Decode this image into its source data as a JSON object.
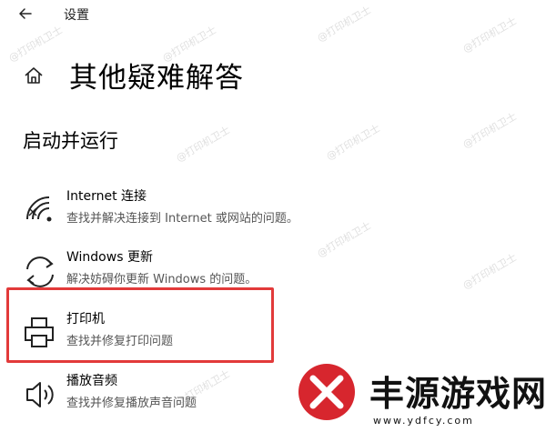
{
  "window": {
    "title": "设置"
  },
  "header": {
    "title": "其他疑难解答"
  },
  "section": {
    "title": "启动并运行"
  },
  "items": [
    {
      "title": "Internet 连接",
      "description": "查找并解决连接到 Internet 或网站的问题。",
      "icon": "wifi-icon"
    },
    {
      "title": "Windows 更新",
      "description": "解决妨碍你更新 Windows 的问题。",
      "icon": "refresh-icon"
    },
    {
      "title": "打印机",
      "description": "查找并修复打印问题",
      "icon": "printer-icon"
    },
    {
      "title": "播放音频",
      "description": "查找并修复播放声音问题",
      "icon": "speaker-icon"
    }
  ],
  "watermark": {
    "text": "@打印机卫士"
  },
  "brand": {
    "name": "丰源游戏网",
    "url": "www.ydfcy.com"
  },
  "colors": {
    "highlight": "#e23a3a",
    "logo": "#d7262e"
  }
}
